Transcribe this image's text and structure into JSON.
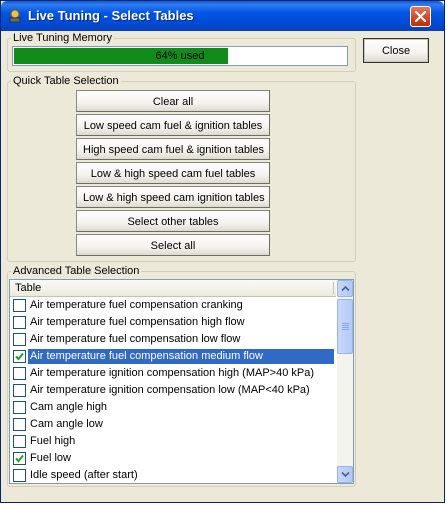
{
  "window": {
    "title": "Live Tuning - Select Tables"
  },
  "memory": {
    "group_label": "Live Tuning Memory",
    "progress_text": "64% used",
    "progress_fraction": 0.64
  },
  "close_button": {
    "label": "Close"
  },
  "quick": {
    "group_label": "Quick Table Selection",
    "buttons": [
      "Clear all",
      "Low speed cam fuel & ignition tables",
      "High speed cam fuel & ignition tables",
      "Low & high speed cam fuel tables",
      "Low & high speed cam ignition tables",
      "Select other tables",
      "Select all"
    ]
  },
  "advanced": {
    "group_label": "Advanced Table Selection",
    "column_header": "Table",
    "rows": [
      {
        "label": "Air temperature fuel compensation cranking",
        "checked": false,
        "selected": false
      },
      {
        "label": "Air temperature fuel compensation high flow",
        "checked": false,
        "selected": false
      },
      {
        "label": "Air temperature fuel compensation low flow",
        "checked": false,
        "selected": false
      },
      {
        "label": "Air temperature fuel compensation medium flow",
        "checked": true,
        "selected": true
      },
      {
        "label": "Air temperature ignition compensation high (MAP>40 kPa)",
        "checked": false,
        "selected": false
      },
      {
        "label": "Air temperature ignition compensation low (MAP<40 kPa)",
        "checked": false,
        "selected": false
      },
      {
        "label": "Cam angle high",
        "checked": false,
        "selected": false
      },
      {
        "label": "Cam angle low",
        "checked": false,
        "selected": false
      },
      {
        "label": "Fuel high",
        "checked": false,
        "selected": false
      },
      {
        "label": "Fuel low",
        "checked": true,
        "selected": false
      },
      {
        "label": "Idle speed (after start)",
        "checked": false,
        "selected": false
      }
    ]
  }
}
